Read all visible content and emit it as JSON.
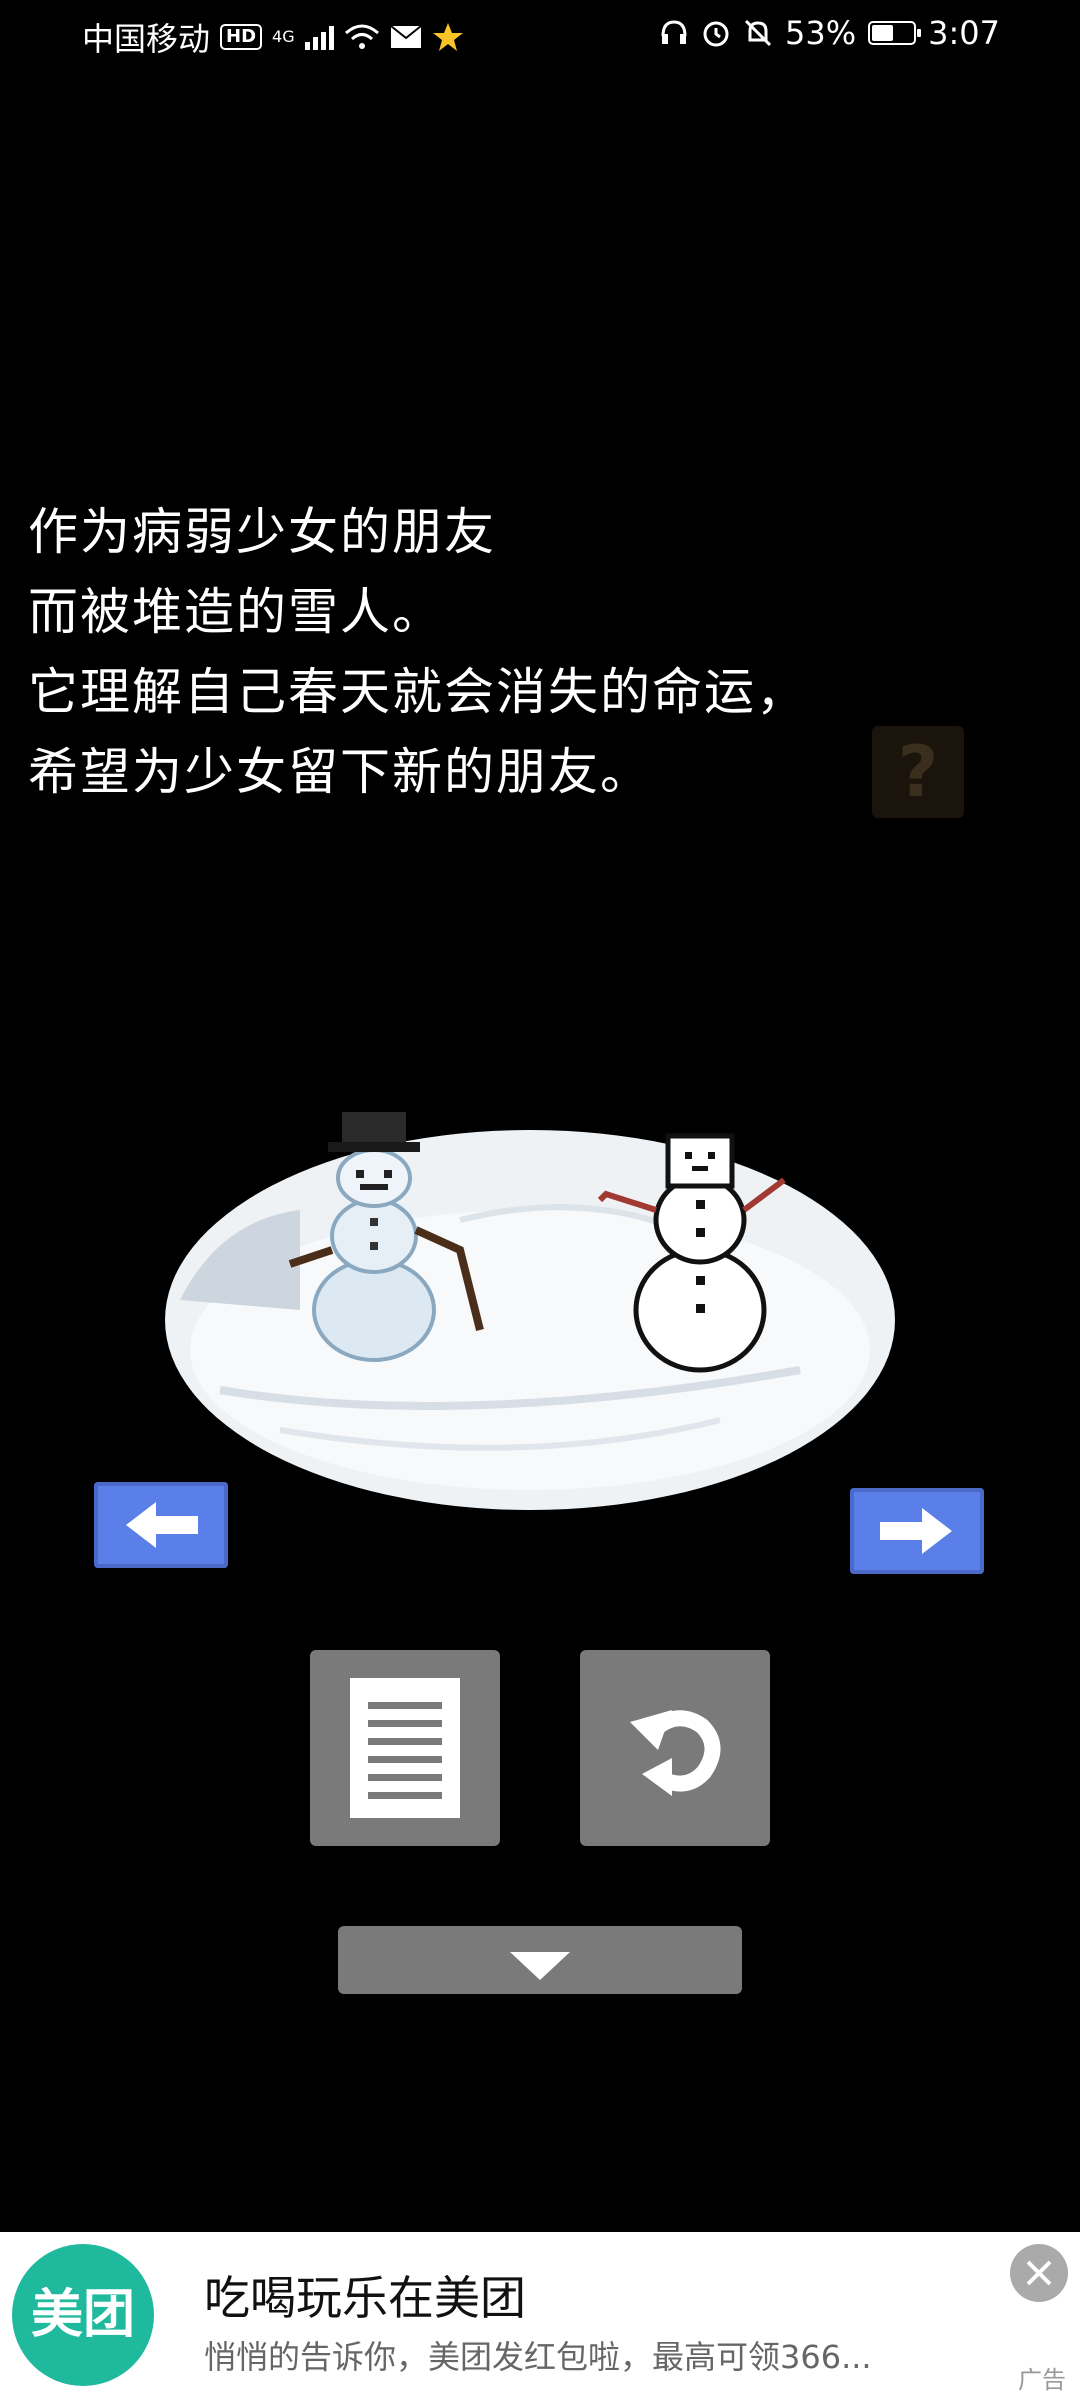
{
  "status_bar": {
    "carrier": "中国移动",
    "hd": "HD",
    "network": "4G",
    "battery_percent_text": "53%",
    "battery_level": 0.53,
    "time": "3:07"
  },
  "story": {
    "lines": [
      "作为病弱少女的朋友",
      "而被堆造的雪人。",
      "它理解自己春天就会消失的命运，",
      "希望为少女留下新的朋友。"
    ]
  },
  "help_button": {
    "label": "?"
  },
  "ad": {
    "logo_text": "美团",
    "title": "吃喝玩乐在美团",
    "description": "悄悄的告诉你，美团发红包啦，最高可领366...",
    "tag": "广告"
  },
  "colors": {
    "background": "#000000",
    "arrow_blue": "#5b7fe8",
    "tool_gray": "#7a7a7a",
    "meituan_green": "#1fb99e"
  }
}
